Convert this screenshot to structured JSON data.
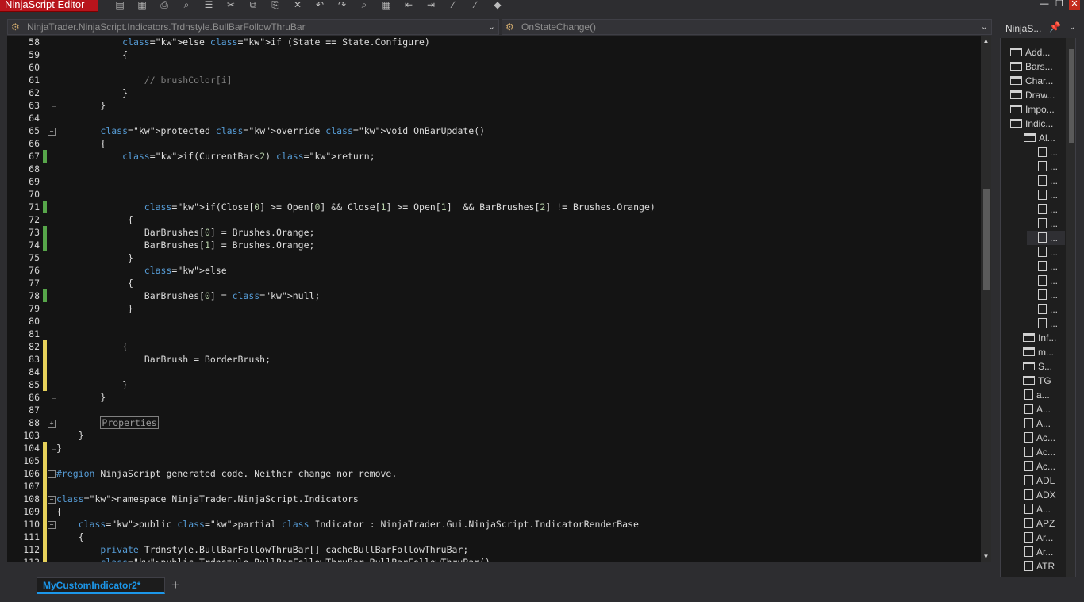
{
  "window": {
    "title": "NinjaScript Editor",
    "min": "—",
    "max": "❐",
    "close": "✕"
  },
  "toolbar": {
    "icons": [
      "save-icon",
      "save-all-icon",
      "print-icon",
      "find-icon",
      "list-icon",
      "cut-icon",
      "copy-icon",
      "paste-icon",
      "delete-icon",
      "undo-icon",
      "redo-icon",
      "find-replace-icon",
      "calculator-icon",
      "outdent-icon",
      "indent-icon",
      "comment-icon",
      "uncomment-icon",
      "visual-studio-icon"
    ]
  },
  "nav": {
    "class_path": "NinjaTrader.NinjaScript.Indicators.Trdnstyle.BullBarFollowThruBar",
    "member": "OnStateChange()"
  },
  "code_lines": [
    {
      "n": "58",
      "code": "            else if (State == State.Configure)"
    },
    {
      "n": "59",
      "code": "            {"
    },
    {
      "n": "60",
      "code": ""
    },
    {
      "n": "61",
      "code": "                // brushColor[i]"
    },
    {
      "n": "62",
      "code": "            }"
    },
    {
      "n": "63",
      "code": "        }"
    },
    {
      "n": "64",
      "code": ""
    },
    {
      "n": "65",
      "code": "        protected override void OnBarUpdate()"
    },
    {
      "n": "66",
      "code": "        {"
    },
    {
      "n": "67",
      "code": "            if(CurrentBar<2) return;"
    },
    {
      "n": "68",
      "code": ""
    },
    {
      "n": "69",
      "code": ""
    },
    {
      "n": "70",
      "code": ""
    },
    {
      "n": "71",
      "code": "                if(Close[0] >= Open[0] && Close[1] >= Open[1]  && BarBrushes[2] != Brushes.Orange)"
    },
    {
      "n": "72",
      "code": "             {"
    },
    {
      "n": "73",
      "code": "                BarBrushes[0] = Brushes.Orange;"
    },
    {
      "n": "74",
      "code": "                BarBrushes[1] = Brushes.Orange;"
    },
    {
      "n": "75",
      "code": "             }"
    },
    {
      "n": "76",
      "code": "                else"
    },
    {
      "n": "77",
      "code": "             {"
    },
    {
      "n": "78",
      "code": "                BarBrushes[0] = null;"
    },
    {
      "n": "79",
      "code": "             }"
    },
    {
      "n": "80",
      "code": ""
    },
    {
      "n": "81",
      "code": ""
    },
    {
      "n": "82",
      "code": "            {"
    },
    {
      "n": "83",
      "code": "                BarBrush = BorderBrush;"
    },
    {
      "n": "84",
      "code": ""
    },
    {
      "n": "85",
      "code": "            }"
    },
    {
      "n": "86",
      "code": "        }"
    },
    {
      "n": "87",
      "code": ""
    },
    {
      "n": "88",
      "code": "        Properties"
    },
    {
      "n": "103",
      "code": "    }"
    },
    {
      "n": "104",
      "code": "}"
    },
    {
      "n": "105",
      "code": ""
    },
    {
      "n": "106",
      "code": "#region NinjaScript generated code. Neither change nor remove."
    },
    {
      "n": "107",
      "code": ""
    },
    {
      "n": "108",
      "code": "namespace NinjaTrader.NinjaScript.Indicators"
    },
    {
      "n": "109",
      "code": "{"
    },
    {
      "n": "110",
      "code": "    public partial class Indicator : NinjaTrader.Gui.NinjaScript.IndicatorRenderBase"
    },
    {
      "n": "111",
      "code": "    {"
    },
    {
      "n": "112",
      "code": "        private Trdnstyle.BullBarFollowThruBar[] cacheBullBarFollowThruBar;"
    },
    {
      "n": "113",
      "code": "        public Trdnstyle.BullBarFollowThruBar BullBarFollowThruBar()"
    }
  ],
  "tabs": [
    {
      "label": "MyCustomIndicator2*"
    }
  ],
  "tab_add": "+",
  "explorer": {
    "title": "NinjaS...",
    "pin": "📌",
    "chevron": "⌄",
    "items": [
      {
        "label": "Add...",
        "type": "folder",
        "open": false
      },
      {
        "label": "Bars...",
        "type": "folder",
        "open": false
      },
      {
        "label": "Char...",
        "type": "folder",
        "open": false
      },
      {
        "label": "Draw...",
        "type": "folder",
        "open": false
      },
      {
        "label": "Impo...",
        "type": "folder",
        "open": false
      },
      {
        "label": "Indic...",
        "type": "folder",
        "open": true
      },
      {
        "label": "Al...",
        "type": "folder",
        "open": true
      },
      {
        "label": "...",
        "type": "file"
      },
      {
        "label": "...",
        "type": "file"
      },
      {
        "label": "...",
        "type": "file"
      },
      {
        "label": "...",
        "type": "file"
      },
      {
        "label": "...",
        "type": "file"
      },
      {
        "label": "...",
        "type": "file"
      },
      {
        "label": "...",
        "type": "file",
        "selected": true
      },
      {
        "label": "...",
        "type": "file"
      },
      {
        "label": "...",
        "type": "file"
      },
      {
        "label": "...",
        "type": "file"
      },
      {
        "label": "...",
        "type": "file"
      },
      {
        "label": "...",
        "type": "file"
      },
      {
        "label": "...",
        "type": "file"
      },
      {
        "label": "Inf...",
        "type": "folder",
        "open": false
      },
      {
        "label": "m...",
        "type": "folder",
        "open": false
      },
      {
        "label": "S...",
        "type": "folder",
        "open": false
      },
      {
        "label": "TG",
        "type": "folder",
        "open": false
      },
      {
        "label": "a...",
        "type": "file"
      },
      {
        "label": "A...",
        "type": "file"
      },
      {
        "label": "A...",
        "type": "file"
      },
      {
        "label": "Ac...",
        "type": "file"
      },
      {
        "label": "Ac...",
        "type": "file"
      },
      {
        "label": "Ac...",
        "type": "file"
      },
      {
        "label": "ADL",
        "type": "file"
      },
      {
        "label": "ADX",
        "type": "file"
      },
      {
        "label": "A...",
        "type": "file"
      },
      {
        "label": "APZ",
        "type": "file"
      },
      {
        "label": "Ar...",
        "type": "file"
      },
      {
        "label": "Ar...",
        "type": "file"
      },
      {
        "label": "ATR",
        "type": "file"
      }
    ]
  }
}
